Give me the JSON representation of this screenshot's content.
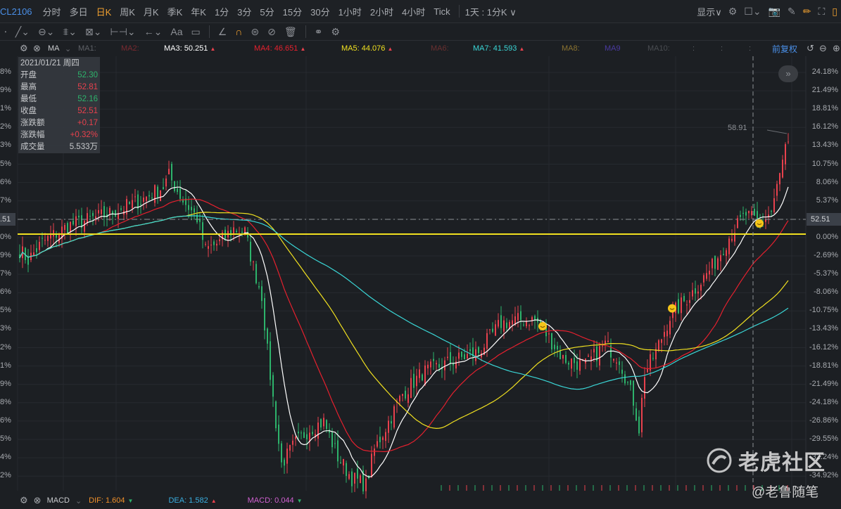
{
  "toolbar": {
    "symbol": "CL2106",
    "timeframes": [
      "分时",
      "多日",
      "日K",
      "周K",
      "月K",
      "季K",
      "年K",
      "1分",
      "3分",
      "5分",
      "15分",
      "30分",
      "1小时",
      "2小时",
      "4小时",
      "Tick"
    ],
    "active": "日K",
    "range_select": "1天 : 1分K ∨",
    "display_label": "显示∨"
  },
  "indicators": {
    "ma_label": "MA",
    "ma1": "MA1:",
    "ma2": "MA2:",
    "ma3": "MA3: 50.251",
    "ma4": "MA4: 46.651",
    "ma5": "MA5: 44.076",
    "ma6": "MA6:",
    "ma7": "MA7: 41.593",
    "ma8": "MA8:",
    "ma9": "MA9",
    "ma10": "MA10:",
    "dots": [
      ":",
      ":",
      ":"
    ],
    "adjust": "前复权",
    "colors": {
      "ma3": "#ffffff",
      "ma4": "#e5202e",
      "ma5": "#f0e020",
      "ma7": "#3ad6d6"
    }
  },
  "info": {
    "date": "2021/01/21 周四",
    "rows": [
      {
        "label": "开盘",
        "value": "52.30",
        "color": "#2db36b"
      },
      {
        "label": "最高",
        "value": "52.81",
        "color": "#e8414d"
      },
      {
        "label": "最低",
        "value": "52.16",
        "color": "#2db36b"
      },
      {
        "label": "收盘",
        "value": "52.51",
        "color": "#e8414d"
      },
      {
        "label": "涨跌额",
        "value": "+0.17",
        "color": "#e8414d"
      },
      {
        "label": "涨跌幅",
        "value": "+0.32%",
        "color": "#e8414d"
      },
      {
        "label": "成交量",
        "value": "5.533万",
        "color": "#c8cacd"
      }
    ]
  },
  "right_axis": [
    "24.18%",
    "21.49%",
    "18.81%",
    "16.12%",
    "13.43%",
    "10.75%",
    "8.06%",
    "5.37%",
    "52.51",
    "0.00%",
    "-2.69%",
    "-5.37%",
    "-8.06%",
    "-10.75%",
    "-13.43%",
    "-16.12%",
    "-18.81%",
    "-21.49%",
    "-24.18%",
    "-26.86%",
    "-29.55%",
    "-32.24%",
    "-34.92%"
  ],
  "left_axis": [
    "8%",
    "9%",
    "1%",
    "2%",
    "3%",
    "5%",
    "6%",
    "7%",
    ".51",
    "0%",
    "9%",
    "7%",
    "6%",
    "5%",
    "3%",
    "2%",
    "1%",
    "9%",
    "8%",
    "6%",
    "5%",
    "4%",
    "2%"
  ],
  "high_label": "58.91",
  "macd": {
    "name": "MACD",
    "dif": "DIF: 1.604",
    "dea": "DEA: 1.582",
    "macd": "MACD: 0.044"
  },
  "watermark": {
    "brand": "老虎社区",
    "author": "@老鲁随笔"
  },
  "chart_data": {
    "type": "candlestick",
    "y_unit": "percent change",
    "ylim": [
      -34.92,
      24.18
    ],
    "reference_line_pct": 0,
    "current_price": 52.51,
    "high_marker": 58.91,
    "close_path": {
      "bar": [
        0,
        3,
        8,
        18,
        31,
        43,
        51,
        53,
        58,
        63,
        66,
        71,
        76,
        80,
        83,
        86,
        88,
        91,
        93,
        98,
        103,
        108,
        113,
        118,
        123,
        126,
        131,
        136,
        143,
        153,
        163,
        171,
        178,
        183,
        188,
        193,
        201,
        208,
        213,
        218,
        220,
        222,
        226,
        231,
        238,
        246,
        253,
        258,
        263,
        267,
        270,
        272,
        273
      ],
      "pct": [
        -1.9,
        -3.4,
        -0.8,
        1.8,
        3.3,
        5.4,
        7.4,
        9.0,
        5.4,
        2.8,
        -1.9,
        -0.8,
        1.2,
        0.7,
        -4.4,
        -8.6,
        -16.9,
        -27.3,
        -33.4,
        -30.3,
        -28.2,
        -27.2,
        -32.4,
        -35.5,
        -36.5,
        -31.3,
        -27.2,
        -23.1,
        -20.0,
        -18.4,
        -16.9,
        -12.7,
        -12.2,
        -12.2,
        -14.8,
        -17.9,
        -18.9,
        -15.8,
        -17.9,
        -24.1,
        -28.2,
        -20.0,
        -16.9,
        -11.7,
        -8.6,
        -4.4,
        0.7,
        3.3,
        1.8,
        3.8,
        9.0,
        13.1,
        13.1
      ]
    },
    "markers_bar": [
      186,
      232,
      263
    ]
  }
}
